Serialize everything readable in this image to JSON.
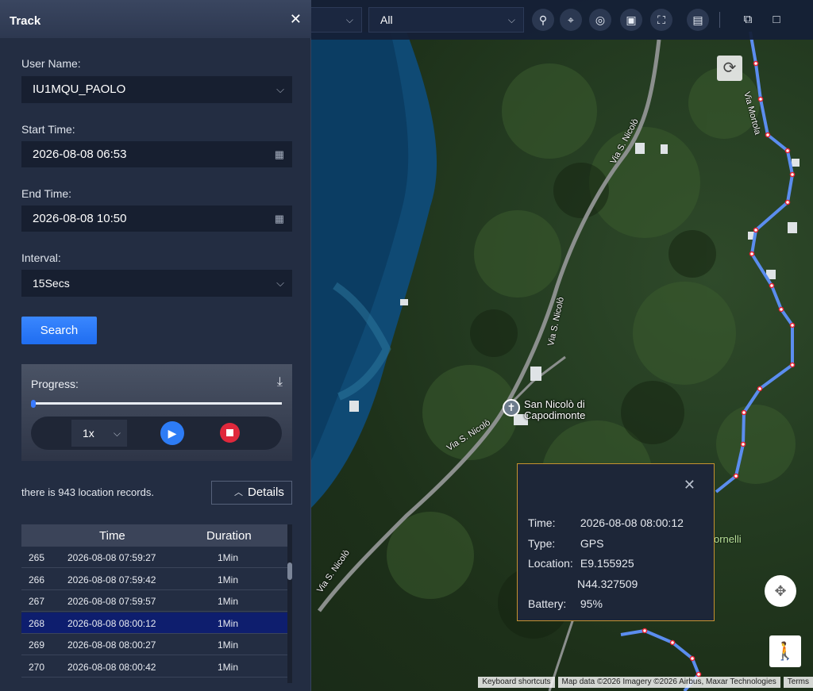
{
  "panel": {
    "title": "Track",
    "user_name_label": "User Name:",
    "user_name_value": "IU1MQU_PAOLO",
    "start_time_label": "Start Time:",
    "start_time_value": "2026-08-08 06:53",
    "end_time_label": "End Time:",
    "end_time_value": "2026-08-08 10:50",
    "interval_label": "Interval:",
    "interval_value": "15Secs",
    "search_label": "Search",
    "progress_label": "Progress:",
    "progress_fraction": 0.0,
    "speed_value": "1x",
    "records_text": "there is 943 location records.",
    "details_label": "Details"
  },
  "table": {
    "columns": [
      "Time",
      "Duration"
    ],
    "rows": [
      {
        "idx": "265",
        "time": "2026-08-08 07:59:27",
        "duration": "1Min",
        "selected": false
      },
      {
        "idx": "266",
        "time": "2026-08-08 07:59:42",
        "duration": "1Min",
        "selected": false
      },
      {
        "idx": "267",
        "time": "2026-08-08 07:59:57",
        "duration": "1Min",
        "selected": false
      },
      {
        "idx": "268",
        "time": "2026-08-08 08:00:12",
        "duration": "1Min",
        "selected": true
      },
      {
        "idx": "269",
        "time": "2026-08-08 08:00:27",
        "duration": "1Min",
        "selected": false
      },
      {
        "idx": "270",
        "time": "2026-08-08 08:00:42",
        "duration": "1Min",
        "selected": false
      }
    ]
  },
  "toolbar": {
    "filter_value": "All"
  },
  "map": {
    "road_label": "Via S. Nicolò",
    "road_label_top": "Via Mortola",
    "poi_name_line1": "San Nicolò di",
    "poi_name_line2": "Capodimonte",
    "partial_label": "ornelli",
    "attribution": {
      "shortcuts": "Keyboard shortcuts",
      "data": "Map data ©2026 Imagery ©2026 Airbus, Maxar Technologies",
      "terms": "Terms"
    },
    "track_color": "#5b8def"
  },
  "popup": {
    "time_label": "Time:",
    "time_value": "2026-08-08 08:00:12",
    "type_label": "Type:",
    "type_value": "GPS",
    "location_label": "Location:",
    "location_lon": "E9.155925",
    "location_lat": "N44.327509",
    "battery_label": "Battery:",
    "battery_value": "95%"
  }
}
